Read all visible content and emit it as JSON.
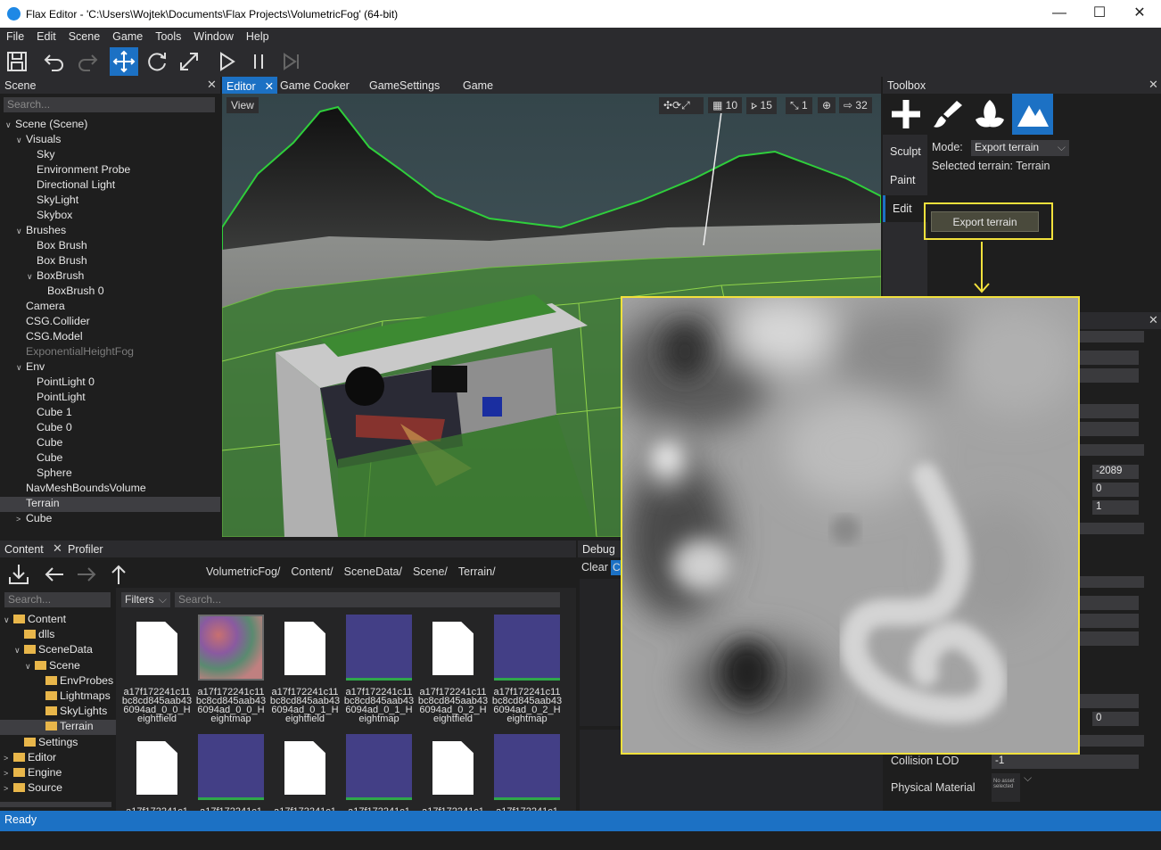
{
  "window": {
    "title": "Flax Editor - 'C:\\Users\\Wojtek\\Documents\\Flax Projects\\VolumetricFog' (64-bit)",
    "minimize": "—",
    "maximize": "☐",
    "close": "✕"
  },
  "menu": [
    "File",
    "Edit",
    "Scene",
    "Game",
    "Tools",
    "Window",
    "Help"
  ],
  "scene_panel": {
    "title": "Scene",
    "search_placeholder": "Search...",
    "items": [
      {
        "label": "Scene (Scene)",
        "depth": 0,
        "arrow": "open"
      },
      {
        "label": "Visuals",
        "depth": 1,
        "arrow": "open"
      },
      {
        "label": "Sky",
        "depth": 2
      },
      {
        "label": "Environment Probe",
        "depth": 2
      },
      {
        "label": "Directional Light",
        "depth": 2
      },
      {
        "label": "SkyLight",
        "depth": 2
      },
      {
        "label": "Skybox",
        "depth": 2
      },
      {
        "label": "Brushes",
        "depth": 1,
        "arrow": "open"
      },
      {
        "label": "Box Brush",
        "depth": 2
      },
      {
        "label": "Box Brush",
        "depth": 2
      },
      {
        "label": "BoxBrush",
        "depth": 2,
        "arrow": "open"
      },
      {
        "label": "BoxBrush 0",
        "depth": 3
      },
      {
        "label": "Camera",
        "depth": 1
      },
      {
        "label": "CSG.Collider",
        "depth": 1
      },
      {
        "label": "CSG.Model",
        "depth": 1
      },
      {
        "label": "ExponentialHeightFog",
        "depth": 1,
        "dim": true
      },
      {
        "label": "Env",
        "depth": 1,
        "arrow": "open"
      },
      {
        "label": "PointLight 0",
        "depth": 2
      },
      {
        "label": "PointLight",
        "depth": 2
      },
      {
        "label": "Cube 1",
        "depth": 2
      },
      {
        "label": "Cube 0",
        "depth": 2
      },
      {
        "label": "Cube",
        "depth": 2
      },
      {
        "label": "Cube",
        "depth": 2
      },
      {
        "label": "Sphere",
        "depth": 2
      },
      {
        "label": "NavMeshBoundsVolume",
        "depth": 1
      },
      {
        "label": "Terrain",
        "depth": 1,
        "selected": true
      },
      {
        "label": "Cube",
        "depth": 1,
        "arrow": "closed"
      }
    ]
  },
  "editor_tabs": [
    {
      "label": "Editor",
      "active": true,
      "closable": true
    },
    {
      "label": "Game Cooker"
    },
    {
      "label": "GameSettings"
    },
    {
      "label": "Game"
    }
  ],
  "viewport": {
    "view_label": "View",
    "grid_value": "10",
    "rotate_snap": "15",
    "scale_snap": "1",
    "camera_speed": "32"
  },
  "toolbox": {
    "title": "Toolbox",
    "tabs": [
      "Sculpt",
      "Paint",
      "Edit"
    ],
    "active_tab": "Edit",
    "mode_label": "Mode:",
    "mode_value": "Export terrain",
    "selected_terrain": "Selected terrain: Terrain",
    "export_button": "Export terrain"
  },
  "properties": {
    "value_1": "-2089",
    "value_2": "0",
    "value_3": "1",
    "value_4": "0",
    "collision_lod_label": "Collision LOD",
    "collision_lod_value": "-1",
    "physical_material_label": "Physical Material",
    "physical_material_preview": "No asset selected"
  },
  "content_panel": {
    "tabs": [
      "Content",
      "Profiler"
    ],
    "breadcrumb": [
      "VolumetricFog/",
      "Content/",
      "SceneData/",
      "Scene/",
      "Terrain/"
    ],
    "search_placeholder": "Search...",
    "filters_label": "Filters",
    "filter_search_placeholder": "Search...",
    "folders": [
      {
        "label": "Content",
        "depth": 0,
        "arrow": "open"
      },
      {
        "label": "dlls",
        "depth": 1
      },
      {
        "label": "SceneData",
        "depth": 1,
        "arrow": "open"
      },
      {
        "label": "Scene",
        "depth": 2,
        "arrow": "open"
      },
      {
        "label": "EnvProbes",
        "depth": 3
      },
      {
        "label": "Lightmaps",
        "depth": 3
      },
      {
        "label": "SkyLights",
        "depth": 3
      },
      {
        "label": "Terrain",
        "depth": 3,
        "selected": true
      },
      {
        "label": "Settings",
        "depth": 1
      },
      {
        "label": "Editor",
        "depth": 0,
        "arrow": "closed"
      },
      {
        "label": "Engine",
        "depth": 0,
        "arrow": "closed"
      },
      {
        "label": "Source",
        "depth": 0,
        "arrow": "closed"
      }
    ],
    "files_row1": [
      {
        "name": "a17f172241c11bc8cd845aab436094ad_0_0_Heightfield",
        "kind": "doc"
      },
      {
        "name": "a17f172241c11bc8cd845aab436094ad_0_0_Heightmap",
        "kind": "noise"
      },
      {
        "name": "a17f172241c11bc8cd845aab436094ad_0_1_Heightfield",
        "kind": "doc"
      },
      {
        "name": "a17f172241c11bc8cd845aab436094ad_0_1_Heightmap",
        "kind": "tex"
      },
      {
        "name": "a17f172241c11bc8cd845aab436094ad_0_2_Heightfield",
        "kind": "doc"
      },
      {
        "name": "a17f172241c11bc8cd845aab436094ad_0_2_Heightmap",
        "kind": "tex"
      }
    ],
    "files_row2": [
      {
        "name": "a17f172241c1",
        "kind": "doc"
      },
      {
        "name": "a17f172241c1",
        "kind": "tex"
      },
      {
        "name": "a17f172241c1",
        "kind": "doc"
      },
      {
        "name": "a17f172241c1",
        "kind": "tex"
      },
      {
        "name": "a17f172241c1",
        "kind": "doc"
      },
      {
        "name": "a17f172241c1",
        "kind": "tex"
      }
    ]
  },
  "debug_panel": {
    "title": "Debug",
    "clear_label": "Clear",
    "clear_label_2": "C"
  },
  "status": "Ready",
  "colors": {
    "accent": "#1c71c4",
    "highlight": "#f2e13c",
    "terrain_green": "#2e8a2e"
  }
}
